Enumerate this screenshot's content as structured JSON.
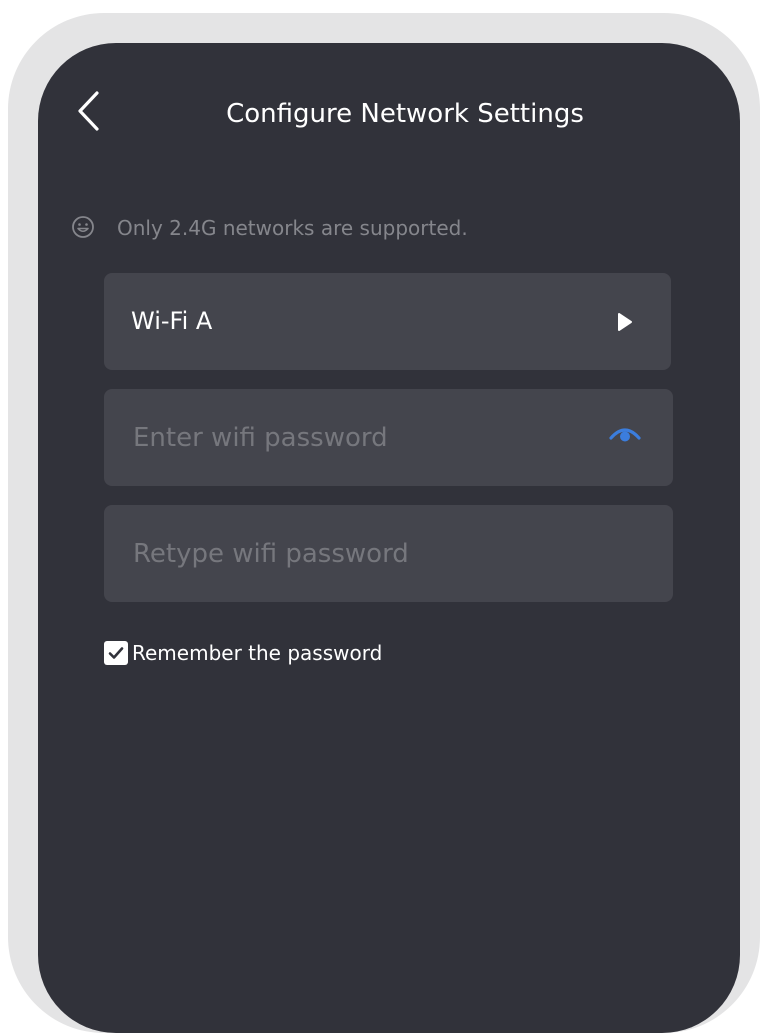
{
  "header": {
    "title": "Configure Network Settings",
    "back_icon": "chevron-left-icon"
  },
  "notice": {
    "icon": "smiley-icon",
    "text": "Only 2.4G networks are supported."
  },
  "network": {
    "selected": "Wi-Fi A",
    "arrow_icon": "play-arrow-icon"
  },
  "password": {
    "value": "",
    "placeholder": "Enter wifi password",
    "eye_icon": "eye-icon",
    "eye_color": "#3b7ddd"
  },
  "retype_password": {
    "value": "",
    "placeholder": "Retype wifi password"
  },
  "remember": {
    "label": "Remember the password",
    "checked": true
  },
  "colors": {
    "screen_bg": "#31323a",
    "field_bg": "#44454d",
    "frame": "#e4e4e5",
    "muted_text": "#85868c",
    "placeholder_text": "#76777d"
  }
}
